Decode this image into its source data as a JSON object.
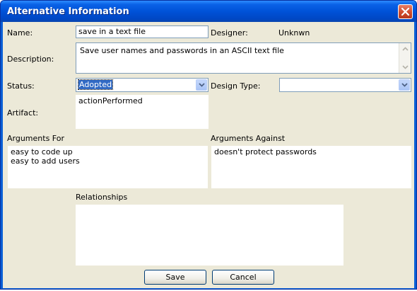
{
  "window": {
    "title": "Alternative Information"
  },
  "form": {
    "name_label": "Name:",
    "name_value": "save in a text file",
    "designer_label": "Designer:",
    "designer_value": "Unknwn",
    "description_label": "Description:",
    "description_value": "Save user names and passwords in an ASCII text file",
    "status_label": "Status:",
    "status_value": "Adopted",
    "design_type_label": "Design Type:",
    "design_type_value": "",
    "artifact_label": "Artifact:",
    "artifact_value": "actionPerformed",
    "arguments_for_label": "Arguments For",
    "arguments_for": [
      "easy to code up",
      "easy to add users"
    ],
    "arguments_against_label": "Arguments Against",
    "arguments_against": [
      "doesn't protect passwords"
    ],
    "relationships_label": "Relationships",
    "relationships_value": ""
  },
  "buttons": {
    "save": "Save",
    "cancel": "Cancel"
  },
  "icons": {
    "close": "close-icon",
    "dropdown": "chevron-down-icon",
    "scroll_up": "arrow-up-icon",
    "scroll_down": "arrow-down-icon"
  },
  "colors": {
    "title_bar": "#0a5fd6",
    "selection": "#316ac5",
    "dialog_bg": "#ece9d8",
    "close_button": "#d04a2c"
  }
}
